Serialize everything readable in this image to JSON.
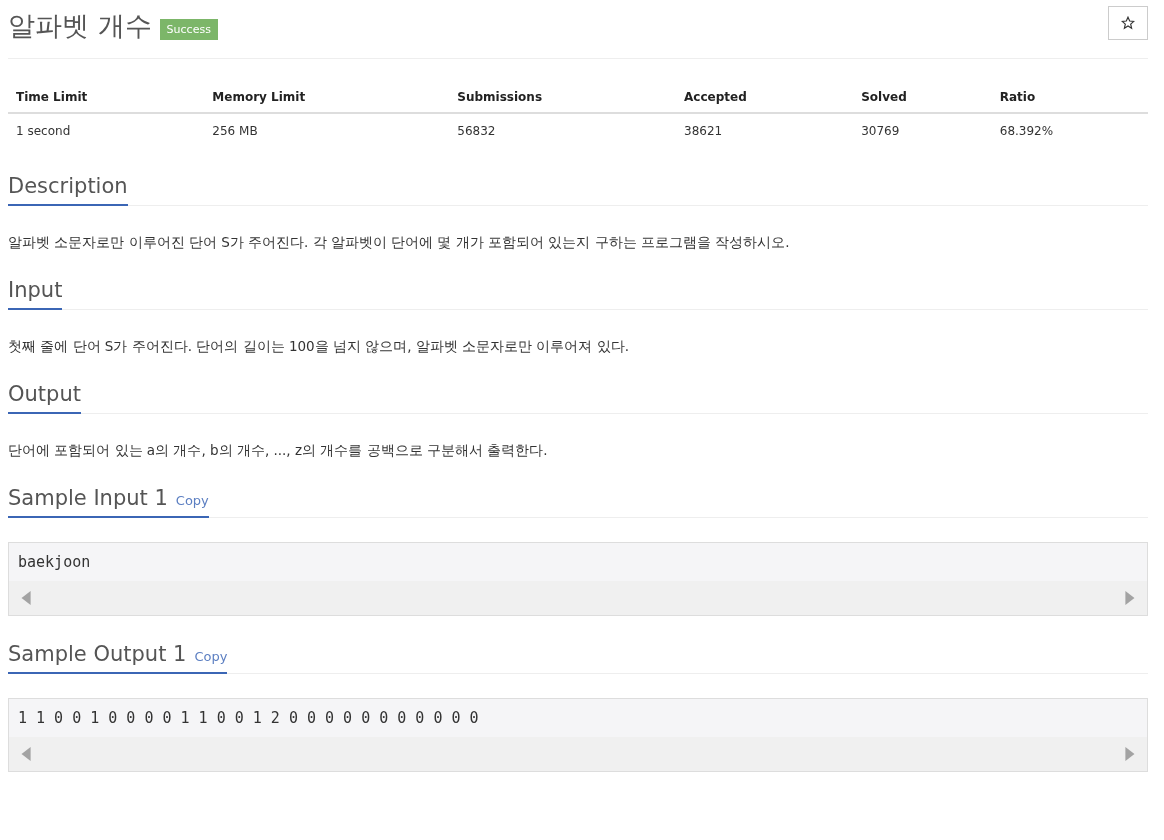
{
  "title": "알파벳 개수",
  "badge": "Success",
  "stats": {
    "columns": [
      "Time Limit",
      "Memory Limit",
      "Submissions",
      "Accepted",
      "Solved",
      "Ratio"
    ],
    "rows": [
      [
        "1 second",
        "256 MB",
        "56832",
        "38621",
        "30769",
        "68.392%"
      ]
    ]
  },
  "sections": [
    {
      "kind": "text",
      "heading": "Description",
      "body": "알파벳 소문자로만 이루어진 단어 S가 주어진다. 각 알파벳이 단어에 몇 개가 포함되어 있는지 구하는 프로그램을 작성하시오."
    },
    {
      "kind": "text",
      "heading": "Input",
      "body": "첫째 줄에 단어 S가 주어진다. 단어의 길이는 100을 넘지 않으며, 알파벳 소문자로만 이루어져 있다."
    },
    {
      "kind": "text",
      "heading": "Output",
      "body": "단어에 포함되어 있는 a의 개수, b의 개수, ..., z의 개수를 공백으로 구분해서 출력한다."
    },
    {
      "kind": "sample",
      "heading": "Sample Input 1",
      "link": "Copy",
      "body": "baekjoon"
    },
    {
      "kind": "sample",
      "heading": "Sample Output 1",
      "link": "Copy",
      "body": "1 1 0 0 1 0 0 0 0 1 1 0 0 1 2 0 0 0 0 0 0 0 0 0 0 0"
    }
  ]
}
